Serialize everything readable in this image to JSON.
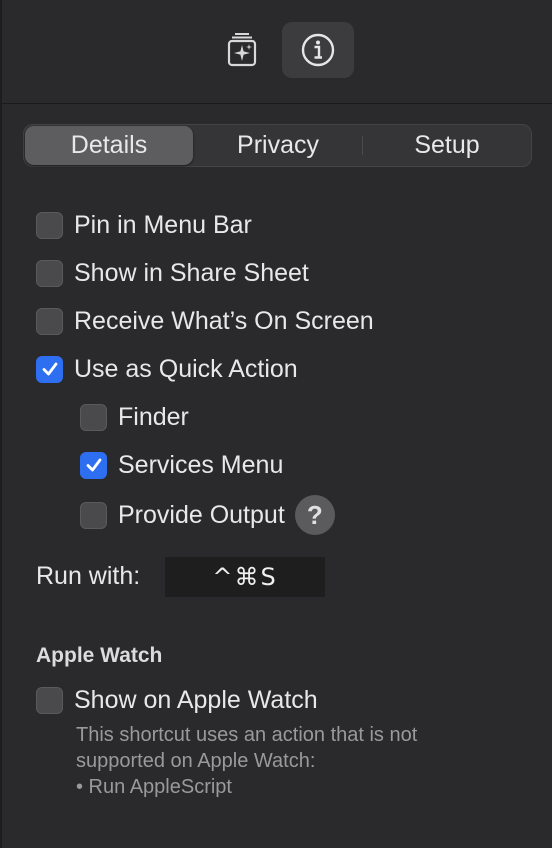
{
  "toolbar": {
    "buttons": [
      {
        "icon": "sparkle-stack-icon"
      },
      {
        "icon": "info-icon",
        "active": true
      }
    ]
  },
  "tabs": {
    "items": [
      "Details",
      "Privacy",
      "Setup"
    ],
    "selected": "Details"
  },
  "options": {
    "pin_menu_bar": {
      "label": "Pin in Menu Bar",
      "checked": false
    },
    "share_sheet": {
      "label": "Show in Share Sheet",
      "checked": false
    },
    "receive_screen": {
      "label": "Receive What’s On Screen",
      "checked": false
    },
    "quick_action": {
      "label": "Use as Quick Action",
      "checked": true
    },
    "finder": {
      "label": "Finder",
      "checked": false
    },
    "services_menu": {
      "label": "Services Menu",
      "checked": true
    },
    "provide_output": {
      "label": "Provide Output",
      "checked": false
    },
    "help_label": "?"
  },
  "run_with": {
    "label": "Run with:",
    "shortcut": "^⌘S"
  },
  "apple_watch": {
    "section_title": "Apple Watch",
    "show_label": "Show on Apple Watch",
    "checked": false,
    "note_lines": [
      "This shortcut uses an action that is not",
      "supported on Apple Watch:",
      "• Run AppleScript"
    ]
  },
  "colors": {
    "accent": "#2d6ff0",
    "background": "#2a292b"
  }
}
